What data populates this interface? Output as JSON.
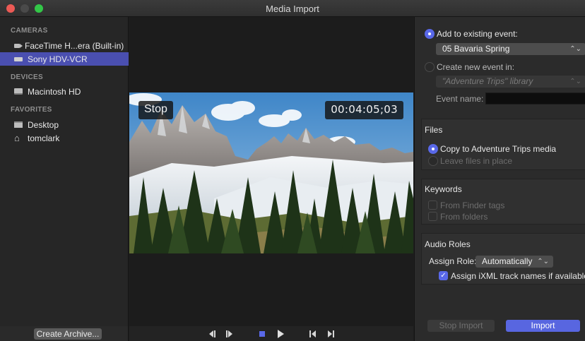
{
  "window": {
    "title": "Media Import"
  },
  "sidebar": {
    "sections": [
      {
        "heading": "CAMERAS",
        "items": [
          {
            "label": "FaceTime H...era (Built-in)",
            "icon": "video-camera-icon",
            "selected": false
          },
          {
            "label": "Sony HDV-VCR",
            "icon": "vcr-icon",
            "selected": true
          }
        ]
      },
      {
        "heading": "DEVICES",
        "items": [
          {
            "label": "Macintosh HD",
            "icon": "hard-drive-icon",
            "selected": false
          }
        ]
      },
      {
        "heading": "FAVORITES",
        "items": [
          {
            "label": "Desktop",
            "icon": "desktop-folder-icon",
            "selected": false
          },
          {
            "label": "tomclark",
            "icon": "home-icon",
            "selected": false
          }
        ]
      }
    ],
    "archive_button": "Create Archive..."
  },
  "viewer": {
    "state_label": "Stop",
    "timecode": "00:04:05;03"
  },
  "transport": {
    "buttons": [
      "skip-back-icon",
      "step-forward-icon",
      "stop-icon",
      "play-icon",
      "go-to-start-icon",
      "go-to-end-icon"
    ]
  },
  "event": {
    "existing_label": "Add to existing event:",
    "existing_selected": true,
    "existing_value": "05 Bavaria Spring",
    "new_label": "Create new event in:",
    "library_value": "\"Adventure Trips\" library",
    "event_name_label": "Event name:",
    "event_name_value": ""
  },
  "files": {
    "heading": "Files",
    "copy_label": "Copy to Adventure Trips media",
    "leave_label": "Leave files in place"
  },
  "keywords": {
    "heading": "Keywords",
    "finder_tags_label": "From Finder tags",
    "folders_label": "From folders"
  },
  "audio_roles": {
    "heading": "Audio Roles",
    "assign_label": "Assign Role:",
    "assign_value": "Automatically",
    "ixml_label": "Assign iXML track names if available"
  },
  "buttons": {
    "stop_import": "Stop Import",
    "import": "Import"
  },
  "colors": {
    "accent": "#5968e8",
    "selection": "#4a4fb0"
  }
}
